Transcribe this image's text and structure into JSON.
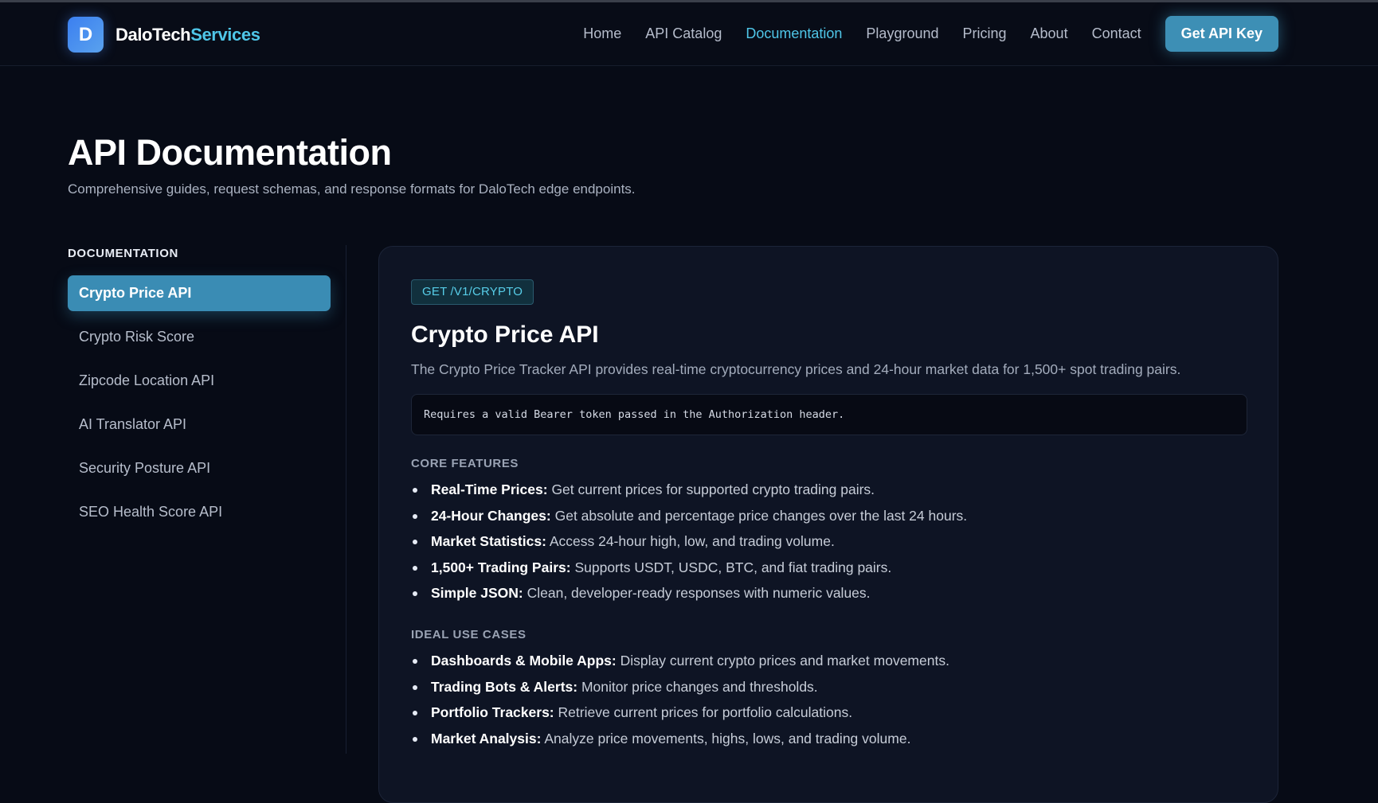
{
  "brand": {
    "mark": "D",
    "name_a": "DaloTech",
    "name_b": "Services"
  },
  "nav": {
    "items": [
      "Home",
      "API Catalog",
      "Documentation",
      "Playground",
      "Pricing",
      "About",
      "Contact"
    ],
    "active": "Documentation",
    "cta": "Get API Key"
  },
  "hero": {
    "title": "API Documentation",
    "subtitle": "Comprehensive guides, request schemas, and response formats for DaloTech edge endpoints."
  },
  "sidebar": {
    "title": "DOCUMENTATION",
    "items": [
      {
        "label": "Crypto Price API",
        "active": true
      },
      {
        "label": "Crypto Risk Score",
        "active": false
      },
      {
        "label": "Zipcode Location API",
        "active": false
      },
      {
        "label": "AI Translator API",
        "active": false
      },
      {
        "label": "Security Posture API",
        "active": false
      },
      {
        "label": "SEO Health Score API",
        "active": false
      }
    ]
  },
  "doc": {
    "endpoint": "GET /V1/CRYPTO",
    "title": "Crypto Price API",
    "description": "The Crypto Price Tracker API provides real-time cryptocurrency prices and 24-hour market data for 1,500+ spot trading pairs.",
    "auth_note": "Requires a valid Bearer token passed in the Authorization header.",
    "features_heading": "CORE FEATURES",
    "features": [
      {
        "term": "Real-Time Prices:",
        "text": "Get current prices for supported crypto trading pairs."
      },
      {
        "term": "24-Hour Changes:",
        "text": "Get absolute and percentage price changes over the last 24 hours."
      },
      {
        "term": "Market Statistics:",
        "text": "Access 24-hour high, low, and trading volume."
      },
      {
        "term": "1,500+ Trading Pairs:",
        "text": "Supports USDT, USDC, BTC, and fiat trading pairs."
      },
      {
        "term": "Simple JSON:",
        "text": "Clean, developer-ready responses with numeric values."
      }
    ],
    "usecases_heading": "IDEAL USE CASES",
    "usecases": [
      {
        "term": "Dashboards & Mobile Apps:",
        "text": "Display current crypto prices and market movements."
      },
      {
        "term": "Trading Bots & Alerts:",
        "text": "Monitor price changes and thresholds."
      },
      {
        "term": "Portfolio Trackers:",
        "text": "Retrieve current prices for portfolio calculations."
      },
      {
        "term": "Market Analysis:",
        "text": "Analyze price movements, highs, lows, and trading volume."
      }
    ]
  }
}
